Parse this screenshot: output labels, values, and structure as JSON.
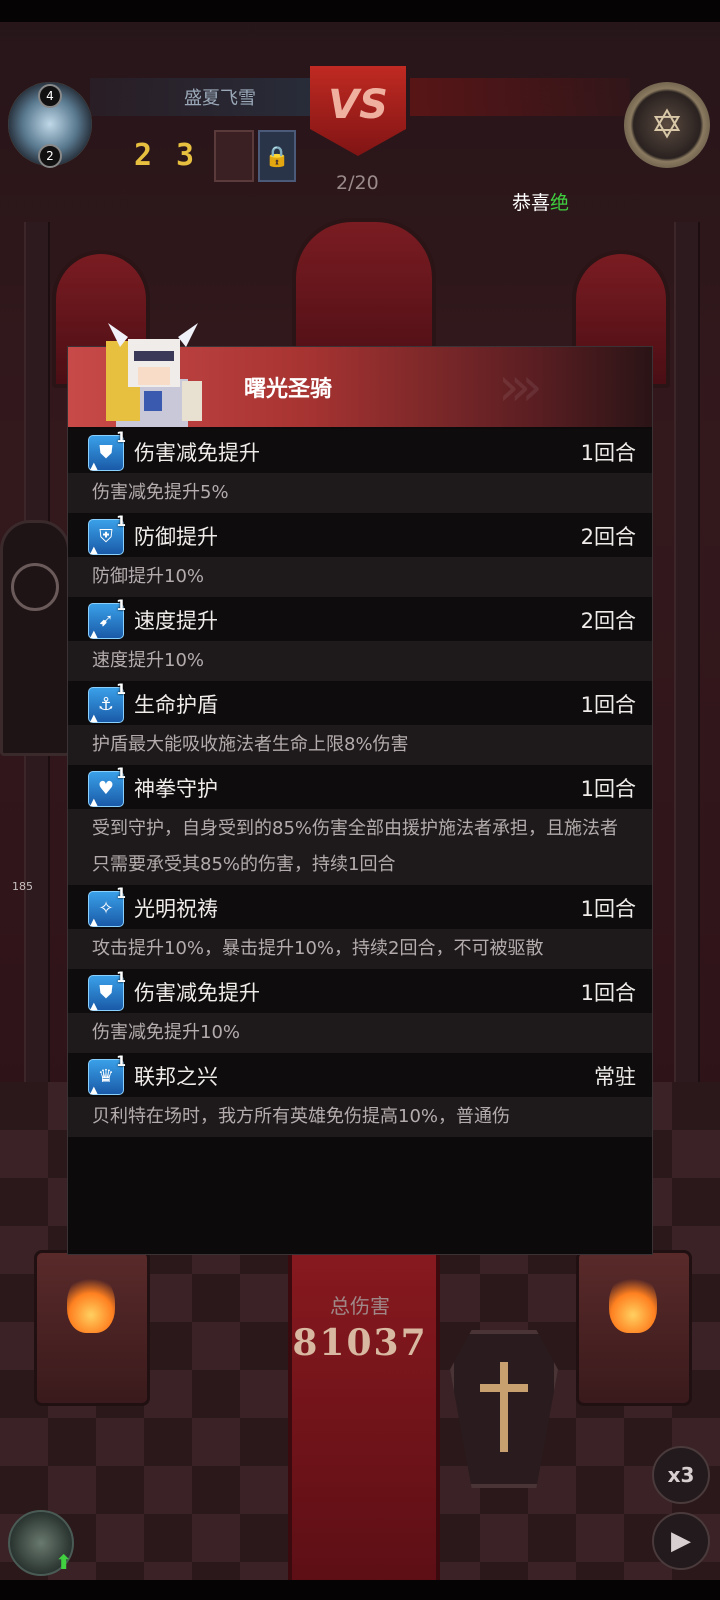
{
  "hud": {
    "team_name": "盛夏飞雪",
    "vs_label": "VS",
    "badge_top": "4",
    "badge_bottom": "2",
    "counter_a": "2",
    "counter_b": "3",
    "round": "2/20",
    "congrats_prefix": "恭喜",
    "congrats_highlight": "绝",
    "hp_small": "185"
  },
  "battle": {
    "total_damage_label": "总伤害",
    "total_damage_value": "81037",
    "speed_label": "x3",
    "play_icon": "play-icon"
  },
  "panel": {
    "hero_name": "曙光圣骑",
    "buffs": [
      {
        "icon": "damage-reduction-icon",
        "level": "1",
        "name": "伤害减免提升",
        "duration": "1回合",
        "desc": "伤害减免提升5%"
      },
      {
        "icon": "shield-defense-icon",
        "level": "1",
        "name": "防御提升",
        "duration": "2回合",
        "desc": "防御提升10%"
      },
      {
        "icon": "boot-speed-icon",
        "level": "1",
        "name": "速度提升",
        "duration": "2回合",
        "desc": "速度提升10%"
      },
      {
        "icon": "anchor-shield-icon",
        "level": "1",
        "name": "生命护盾",
        "duration": "1回合",
        "desc": "护盾最大能吸收施法者生命上限8%伤害"
      },
      {
        "icon": "heart-fist-icon",
        "level": "1",
        "name": "神拳守护",
        "duration": "1回合",
        "desc": "受到守护，自身受到的85%伤害全部由援护施法者承担，且施法者只需要承受其85%的伤害，持续1回合"
      },
      {
        "icon": "light-blessing-icon",
        "level": "1",
        "name": "光明祝祷",
        "duration": "1回合",
        "desc": "攻击提升10%，暴击提升10%，持续2回合，不可被驱散"
      },
      {
        "icon": "damage-reduction-icon",
        "level": "1",
        "name": "伤害减免提升",
        "duration": "1回合",
        "desc": "伤害减免提升10%"
      },
      {
        "icon": "federation-icon",
        "level": "1",
        "name": "联邦之兴",
        "duration": "常驻",
        "desc": "贝利特在场时，我方所有英雄免伤提高10%，普通伤"
      }
    ]
  }
}
